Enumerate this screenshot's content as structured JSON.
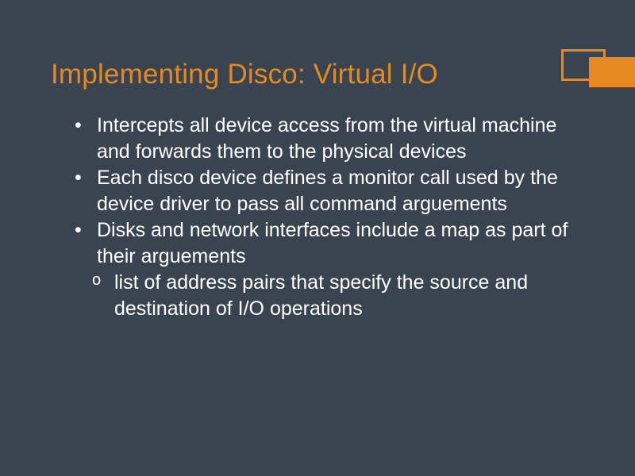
{
  "slide": {
    "title": "Implementing Disco: Virtual I/O",
    "bullets": [
      "Intercepts all device access from the virtual machine and forwards them to the physical devices",
      "Each disco device defines a monitor call used by the device driver to pass all command arguements",
      "Disks and network interfaces include a map as part of their arguements"
    ],
    "sub_bullets": [
      "list of address pairs that specify the source and destination of I/O operations"
    ]
  }
}
